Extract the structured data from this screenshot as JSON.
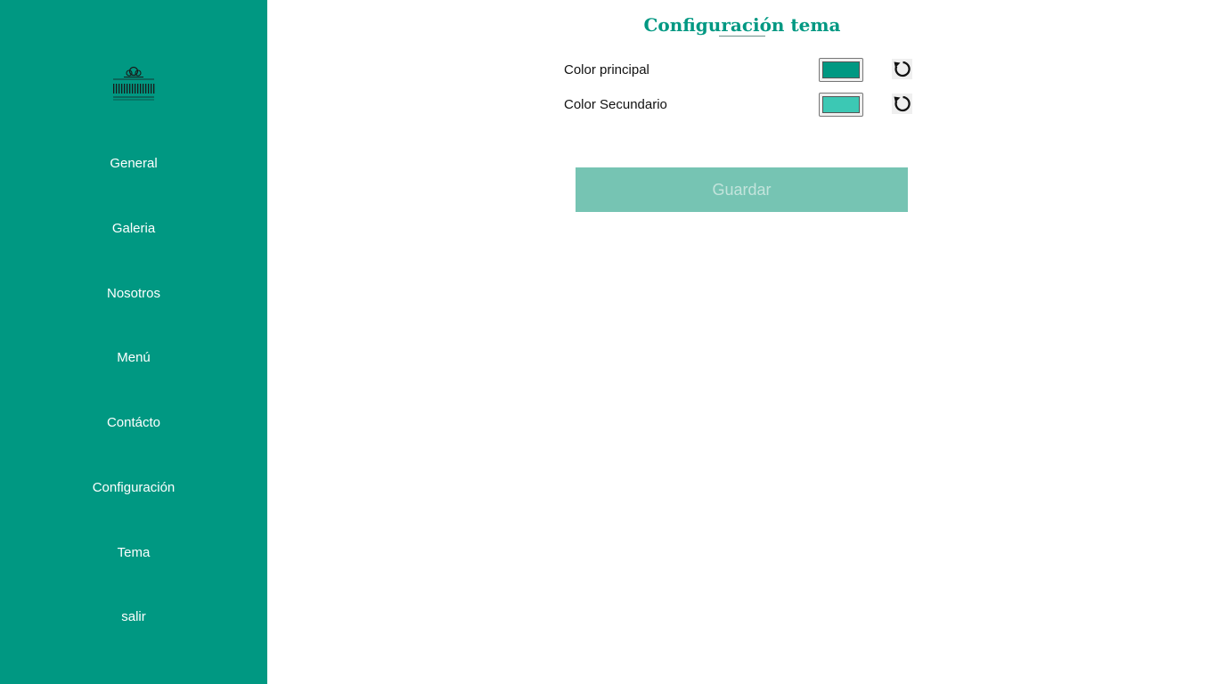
{
  "sidebar": {
    "logo_icon": "restaurant-logo",
    "items": [
      {
        "label": "General"
      },
      {
        "label": "Galeria"
      },
      {
        "label": "Nosotros"
      },
      {
        "label": "Menú"
      },
      {
        "label": "Contácto"
      },
      {
        "label": "Configuración"
      },
      {
        "label": "Tema"
      },
      {
        "label": "salir"
      }
    ],
    "background_color": "#009882"
  },
  "main": {
    "title": "Configuración tema",
    "rows": [
      {
        "label": "Color principal",
        "value": "#009882",
        "reset_icon": "refresh-icon"
      },
      {
        "label": "Color Secundario",
        "value": "#3cc8b4",
        "reset_icon": "refresh-icon"
      }
    ],
    "save_label": "Guardar",
    "save_disabled": true
  },
  "colors": {
    "accent": "#009882",
    "button_disabled": "#76c4b3"
  }
}
